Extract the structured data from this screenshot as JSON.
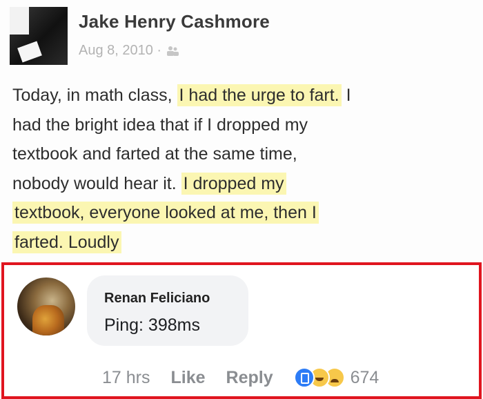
{
  "post": {
    "author": "Jake Henry Cashmore",
    "date": "Aug 8, 2010 ·",
    "audience_icon": "friends-icon",
    "text": {
      "l1a": "Today, in math class, ",
      "l1b": "I had the urge to fart.",
      "l1c": " I",
      "l2": "had the bright idea that if I dropped my",
      "l3": "textbook and farted at the same time,",
      "l4a": "nobody would hear it. ",
      "l4b": "I dropped my",
      "l5": "textbook, everyone looked at me, then I",
      "l6": "farted. Loudly"
    },
    "highlight_color": "#fbf6b2"
  },
  "comment": {
    "author": "Renan Feliciano",
    "text": "Ping: 398ms",
    "time": "17 hrs",
    "like_label": "Like",
    "reply_label": "Reply",
    "reaction_count": "674",
    "reaction_icons": [
      "like-reaction-icon",
      "haha-reaction-icon",
      "sad-reaction-icon"
    ],
    "border_color": "#e0151f"
  }
}
